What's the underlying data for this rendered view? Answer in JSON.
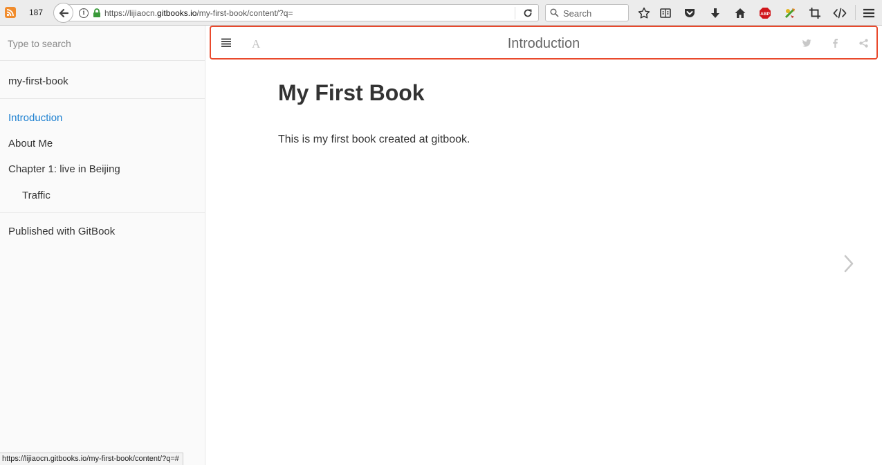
{
  "browser": {
    "tab_count": "187",
    "url_prefix": "https://lijiaocn.",
    "url_host": "gitbooks.io",
    "url_path": "/my-first-book/content/?q=",
    "search_placeholder": "Search",
    "abp_label": "ABP"
  },
  "sidebar": {
    "search_placeholder": "Type to search",
    "book_title": "my-first-book",
    "items": [
      {
        "label": "Introduction",
        "active": true
      },
      {
        "label": "About Me"
      },
      {
        "label": "Chapter 1: live in Beijing"
      },
      {
        "label": "Traffic"
      }
    ],
    "footer": "Published with GitBook"
  },
  "header": {
    "title": "Introduction",
    "font_icon_label": "A"
  },
  "page": {
    "heading": "My First Book",
    "paragraph": "This is my first book created at gitbook."
  },
  "status_bar": {
    "text": "https://lijiaocn.gitbooks.io/my-first-book/content/?q=#"
  },
  "colors": {
    "accent_link": "#1b7fd0",
    "highlight_border": "#e9492c",
    "text": "#333333"
  },
  "icons": [
    "rss-icon",
    "back-arrow-icon",
    "info-icon",
    "lock-icon",
    "reload-icon",
    "search-icon",
    "star-icon",
    "reader-icon",
    "pocket-icon",
    "download-icon",
    "home-icon",
    "adblock-icon",
    "extension-icon",
    "crop-icon",
    "devtools-icon",
    "menu-icon",
    "hamburger-icon",
    "font-settings-icon",
    "twitter-icon",
    "facebook-icon",
    "share-icon",
    "chevron-right-icon"
  ]
}
